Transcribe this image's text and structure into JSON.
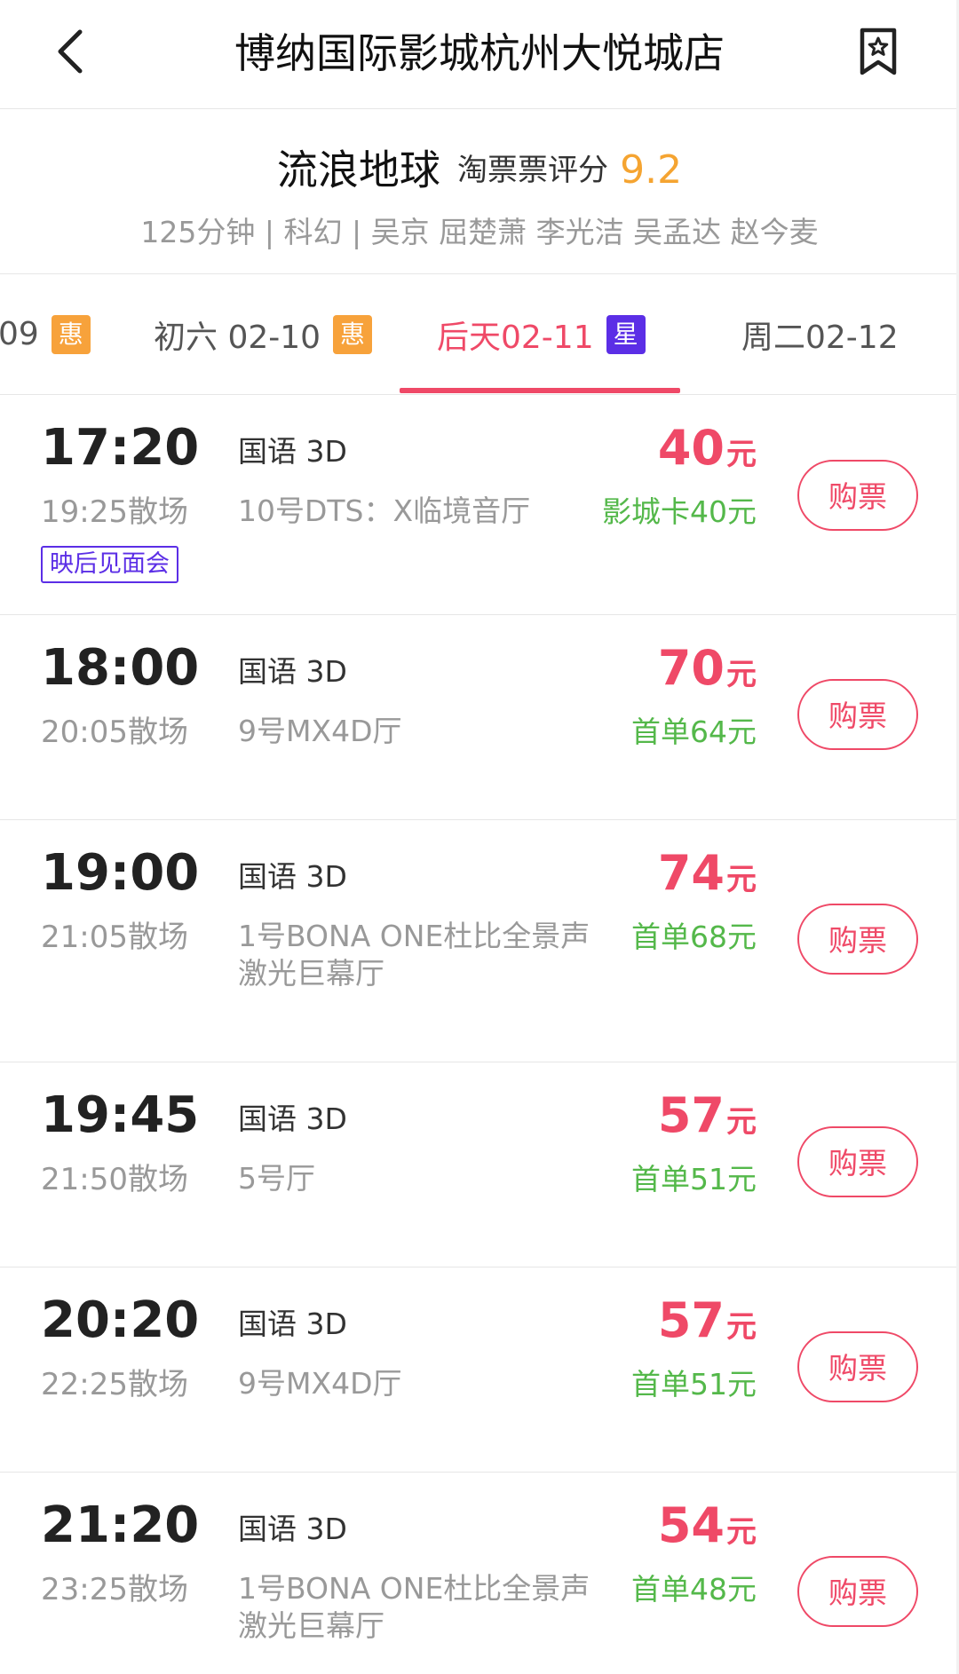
{
  "header": {
    "title": "博纳国际影城杭州大悦城店"
  },
  "movie": {
    "title": "流浪地球",
    "rating_label": "淘票票评分",
    "rating_score": "9.2",
    "meta": "125分钟 | 科幻 | 吴京 屈楚萧 李光洁 吴孟达 赵今麦"
  },
  "date_tabs": [
    {
      "label": "09",
      "badge": "惠",
      "active": false
    },
    {
      "label": "初六 02-10",
      "badge": "惠",
      "active": false
    },
    {
      "label": "后天02-11",
      "badge": "星",
      "active": true
    },
    {
      "label": "周二02-12",
      "badge": "",
      "active": false
    }
  ],
  "colors": {
    "accent": "#ef4967",
    "discount": "#54b84a",
    "rating": "#f5a431",
    "badge_hui": "#f7a23b",
    "badge_xing": "#5b2ee6"
  },
  "showtimes": [
    {
      "start": "17:20",
      "end": "19:25散场",
      "language": "国语 3D",
      "hall": "10号DTS：X临境音厅",
      "price": "40",
      "unit": "元",
      "discount": "影城卡40元",
      "tag": "映后见面会",
      "button": "购票"
    },
    {
      "start": "18:00",
      "end": "20:05散场",
      "language": "国语 3D",
      "hall": "9号MX4D厅",
      "price": "70",
      "unit": "元",
      "discount": "首单64元",
      "tag": "",
      "button": "购票"
    },
    {
      "start": "19:00",
      "end": "21:05散场",
      "language": "国语 3D",
      "hall": "1号BONA ONE杜比全景声激光巨幕厅",
      "price": "74",
      "unit": "元",
      "discount": "首单68元",
      "tag": "",
      "button": "购票"
    },
    {
      "start": "19:45",
      "end": "21:50散场",
      "language": "国语 3D",
      "hall": "5号厅",
      "price": "57",
      "unit": "元",
      "discount": "首单51元",
      "tag": "",
      "button": "购票"
    },
    {
      "start": "20:20",
      "end": "22:25散场",
      "language": "国语 3D",
      "hall": "9号MX4D厅",
      "price": "57",
      "unit": "元",
      "discount": "首单51元",
      "tag": "",
      "button": "购票"
    },
    {
      "start": "21:20",
      "end": "23:25散场",
      "language": "国语 3D",
      "hall": "1号BONA ONE杜比全景声激光巨幕厅",
      "price": "54",
      "unit": "元",
      "discount": "首单48元",
      "tag": "",
      "button": "购票"
    }
  ]
}
